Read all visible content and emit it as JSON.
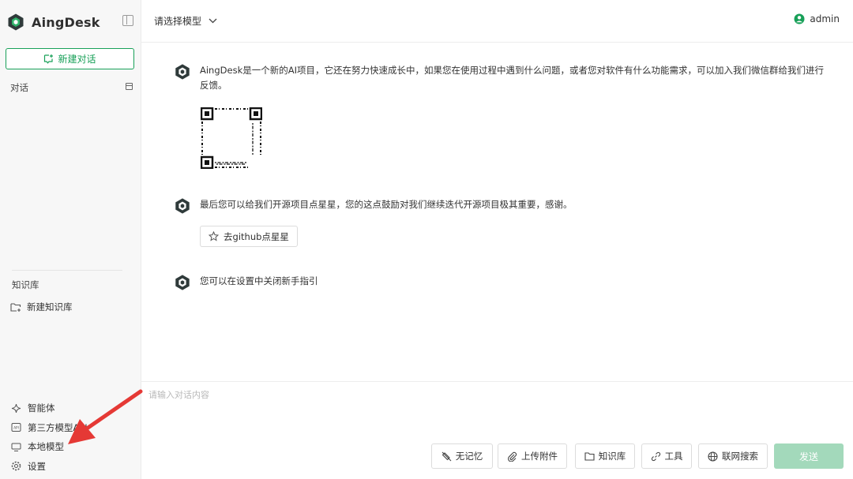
{
  "app": {
    "name": "AingDesk"
  },
  "sidebar": {
    "new_chat_label": "新建对话",
    "conversations_label": "对话",
    "knowledge_label": "知识库",
    "new_knowledge_label": "新建知识库",
    "nav": [
      {
        "label": "智能体",
        "icon": "sparkle-icon"
      },
      {
        "label": "第三方模型API",
        "icon": "api-icon"
      },
      {
        "label": "本地模型",
        "icon": "monitor-icon"
      },
      {
        "label": "设置",
        "icon": "gear-icon"
      }
    ]
  },
  "header": {
    "model_placeholder": "请选择模型",
    "user_name": "admin"
  },
  "messages": [
    {
      "text": "AingDesk是一个新的AI项目，它还在努力快速成长中，如果您在使用过程中遇到什么问题，或者您对软件有什么功能需求，可以加入我们微信群给我们进行反馈。"
    },
    {
      "text": "最后您可以给我们开源项目点星星，您的这点鼓励对我们继续迭代开源项目极其重要，感谢。",
      "button_label": "去github点星星"
    },
    {
      "text": "您可以在设置中关闭新手指引"
    }
  ],
  "input": {
    "placeholder": "请输入对话内容",
    "tools": {
      "memory": "无记忆",
      "attach": "上传附件",
      "knowledge": "知识库",
      "tools": "工具",
      "web_search": "联网搜索"
    },
    "send_label": "发送"
  },
  "colors": {
    "accent": "#18a058",
    "send_disabled": "#a3d9bb",
    "annotation_arrow": "#e53935"
  }
}
